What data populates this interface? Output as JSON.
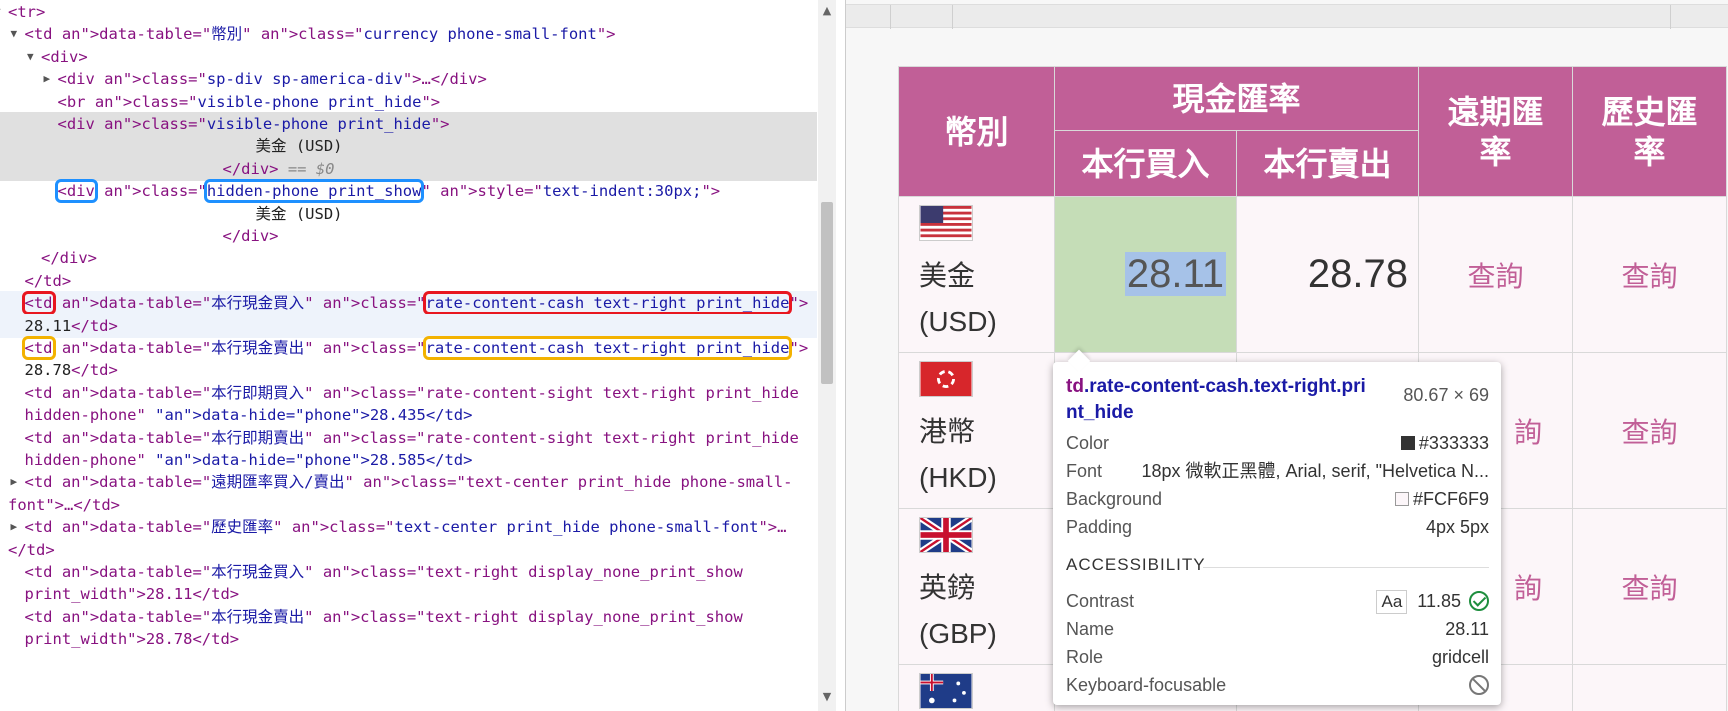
{
  "devtools": {
    "lines": [
      {
        "t": "<tr>"
      },
      {
        "t": "<td data-table=\"幣別\" class=\"currency phone-small-font\">"
      },
      {
        "t": "<div>"
      },
      {
        "t": "<div class=\"sp-div sp-america-div\">…</div>"
      },
      {
        "t": "<br class=\"visible-phone print_hide\">"
      },
      {
        "t": "<div class=\"visible-phone print_hide\">"
      },
      {
        "t": "美金 (USD)"
      },
      {
        "t": "</div> == $0"
      },
      {
        "t": "<div class=\"hidden-phone print_show\" style=\"text-indent:30px;\">"
      },
      {
        "t": "美金 (USD)"
      },
      {
        "t": "</div>"
      },
      {
        "t": "</div>"
      },
      {
        "t": "</td>"
      },
      {
        "t": "<td data-table=\"本行現金買入\" class=\"rate-content-cash text-right print_hide\">"
      },
      {
        "t": "28.11</td>"
      },
      {
        "t": "<td data-table=\"本行現金賣出\" class=\"rate-content-cash text-right print_hide\">"
      },
      {
        "t": "28.78</td>"
      },
      {
        "t": "<td data-table=\"本行即期買入\" class=\"rate-content-sight text-right print_hide"
      },
      {
        "t": "hidden-phone\" data-hide=\"phone\">28.435</td>"
      },
      {
        "t": "<td data-table=\"本行即期賣出\" class=\"rate-content-sight text-right print_hide"
      },
      {
        "t": "hidden-phone\" data-hide=\"phone\">28.585</td>"
      },
      {
        "t": "<td data-table=\"遠期匯率買入/賣出\" class=\"text-center print_hide phone-small-"
      },
      {
        "t": "font\">…</td>"
      },
      {
        "t": "<td data-table=\"歷史匯率\" class=\"text-center print_hide phone-small-font\">…"
      },
      {
        "t": "</td>"
      },
      {
        "t": "<td data-table=\"本行現金買入\" class=\"text-right display_none_print_show"
      },
      {
        "t": "print_width\">28.11</td>"
      },
      {
        "t": "<td data-table=\"本行現金賣出\" class=\"text-right display_none_print_show"
      },
      {
        "t": "print_width\">28.78</td>"
      }
    ]
  },
  "table": {
    "headers": {
      "currency": "幣別",
      "cash": "現金匯率",
      "buy": "本行買入",
      "sell": "本行賣出",
      "forward": "遠期匯\n率",
      "history": "歷史匯\n率"
    },
    "rows": [
      {
        "name": "美金",
        "code": "(USD)",
        "buy": "28.11",
        "sell": "28.78",
        "forward": "查詢",
        "history": "查詢",
        "flag": "us-flag"
      },
      {
        "name": "港幣",
        "code": "(HKD)",
        "forward": "詢",
        "history": "查詢",
        "flag": "hk-flag"
      },
      {
        "name": "英鎊",
        "code": "(GBP)",
        "forward": "詢",
        "history": "查詢",
        "flag": "gb-flag"
      }
    ]
  },
  "tooltip": {
    "selector_tag": "td",
    "selector_class": ".rate-content-cash.text-right.pri\nnt_hide",
    "size": "80.67 × 69",
    "color_label": "Color",
    "color_value": "#333333",
    "font_label": "Font",
    "font_value": "18px 微軟正黑體, Arial, serif, \"Helvetica N...",
    "bg_label": "Background",
    "bg_value": "#FCF6F9",
    "padding_label": "Padding",
    "padding_value": "4px 5px",
    "accessibility": "ACCESSIBILITY",
    "contrast_label": "Contrast",
    "contrast_aa": "Aa",
    "contrast_value": "11.85",
    "name_label": "Name",
    "name_value": "28.11",
    "role_label": "Role",
    "role_value": "gridcell",
    "focus_label": "Keyboard-focusable"
  },
  "colors": {
    "header_bg": "#c15f97",
    "cell_bg": "#fcf6f9",
    "highlight": "#c5ddb7",
    "tag": "#881280",
    "attr_name": "#994500",
    "attr_value": "#1a1aa6"
  }
}
